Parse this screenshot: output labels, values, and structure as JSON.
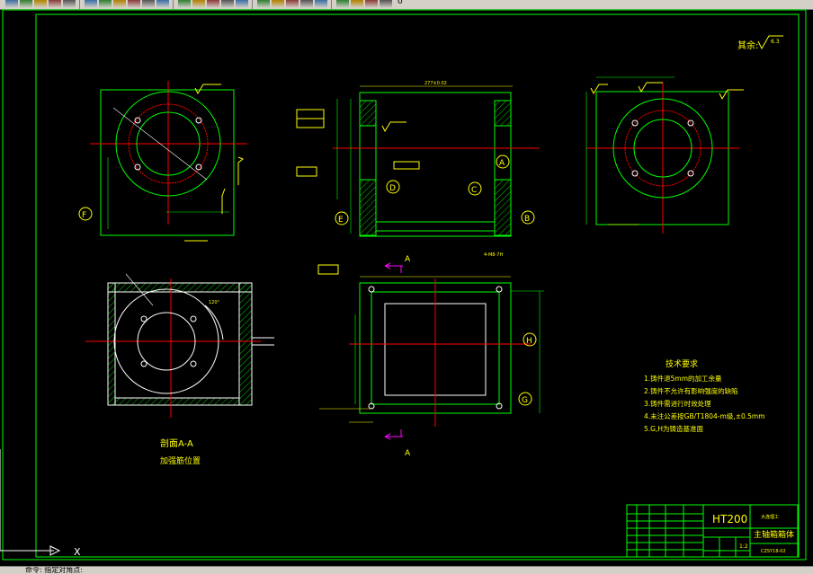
{
  "colors": {
    "background": "#000000",
    "frame": "#00ff00",
    "annotation": "#ffff00",
    "centerline": "#ff0000",
    "section_marker": "#ff00ff",
    "part": "#ffffff",
    "toolbar": "#d4d0c8"
  },
  "toolbar": {
    "icons": [
      "save-icon",
      "print-icon",
      "preview-icon",
      "publish-icon",
      "plot-icon",
      "cut-icon",
      "copy-icon",
      "paste-icon",
      "match-properties-icon",
      "block-editor-icon",
      "undo-icon",
      "redo-icon",
      "pan-icon",
      "zoom-realtime-icon",
      "zoom-window-icon",
      "zoom-previous-icon",
      "properties-icon",
      "design-center-icon",
      "tool-palettes-icon",
      "sheet-set-icon",
      "markup-icon",
      "calculator-icon",
      "help-icon",
      "layer-manager-icon",
      "layer-state-icon"
    ],
    "layer_value": "0"
  },
  "drawing": {
    "roughness_note": "其余:",
    "roughness_value": "6.3",
    "section_label": "剖面A-A",
    "section_sublabel": "加强筋位置",
    "section_letter": "A",
    "view_markers": [
      "A",
      "B",
      "C",
      "D",
      "E",
      "F",
      "G",
      "H"
    ],
    "dim_overall": "277±0.02",
    "dim_bottom": "4-M8-7H",
    "angle_label": "120°",
    "tech_title": "技术要求",
    "tech_items": [
      "1.铸件退5mm的加工余量",
      "2.铸件不允许有影响强度的缺陷",
      "3.铸件需进行时效处理",
      "4.未注公差按GB/T1804-m级,±0.5mm",
      "5.G,H为铸造基准面"
    ]
  },
  "title_block": {
    "material": "HT200",
    "name": "主轴箱箱体",
    "company": "大连理工",
    "drawing_number": "CZSY18-02",
    "scale": "1:2"
  },
  "status": {
    "command_text": "命令: 指定对角点:"
  },
  "ucs": {
    "x_label": "X"
  }
}
